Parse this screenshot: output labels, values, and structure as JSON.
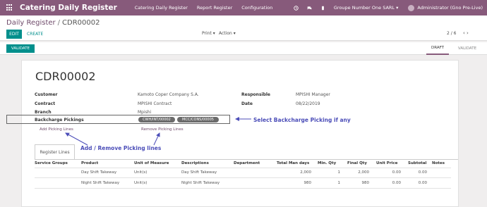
{
  "navbar": {
    "app_title": "Catering Daily Register",
    "menu": [
      "Catering Daily Register",
      "Report Register",
      "Configuration"
    ],
    "company": "Groupe Number One SARL",
    "user": "Administrator (Gno Pre-Live)"
  },
  "control": {
    "breadcrumb_parent": "Daily Register",
    "breadcrumb_separator": "/",
    "breadcrumb_current": "CDR00002",
    "edit": "EDIT",
    "create": "CREATE",
    "print": "Print ▾",
    "action": "Action ▾",
    "pager": "2 / 6",
    "pager_arrows": "‹  ›"
  },
  "status": {
    "validate": "VALIDATE",
    "draft": "DRAFT",
    "validated": "VALIDATE"
  },
  "form": {
    "title": "CDR00002",
    "customer_label": "Customer",
    "customer_value": "Kamoto Coper Company S.A.",
    "contract_label": "Contract",
    "contract_value": "MPISHI Contract",
    "branch_label": "Branch",
    "branch_value": "Mpishi",
    "responsible_label": "Responsible",
    "responsible_value": "MPISHI Manager",
    "date_label": "Date",
    "date_value": "08/22/2019",
    "backcharge_label": "Backcharge Pickings",
    "tags": [
      "CWH/INT/00002",
      "MCC/CONS/00005"
    ],
    "add_picking": "Add Picking Lines",
    "remove_picking": "Remove Picking Lines"
  },
  "annotations": {
    "select_backcharge": "Select Backcharge Picking if any",
    "add_remove": "Add / Remove Picking lines"
  },
  "tabs": {
    "register_lines": "Register Lines"
  },
  "table": {
    "headers": [
      "Service Groups",
      "Product",
      "Unit of Measure",
      "Descriptions",
      "Department",
      "Total Man days",
      "Min. Qty",
      "Final Qty",
      "Unit Price",
      "Subtotal",
      "Notes"
    ],
    "rows": [
      {
        "product": "Day Shift Takeway",
        "uom": "Unit(s)",
        "description": "Day Shift Takeway",
        "man_days": "2,000",
        "min_qty": "1",
        "final_qty": "2,000",
        "unit_price": "0.00",
        "subtotal": "0.00"
      },
      {
        "product": "Night Shift Takeway",
        "uom": "Unit(s)",
        "description": "Night Shift Takeway",
        "man_days": "980",
        "min_qty": "1",
        "final_qty": "980",
        "unit_price": "0.00",
        "subtotal": "0.00"
      }
    ]
  },
  "colors": {
    "navbar": "#875a7b",
    "primary_button": "#008f8c",
    "annotation": "#4b4db8"
  },
  "icons": [
    "apps-grid-icon",
    "clock-icon",
    "chat-icon",
    "mobile-icon"
  ]
}
